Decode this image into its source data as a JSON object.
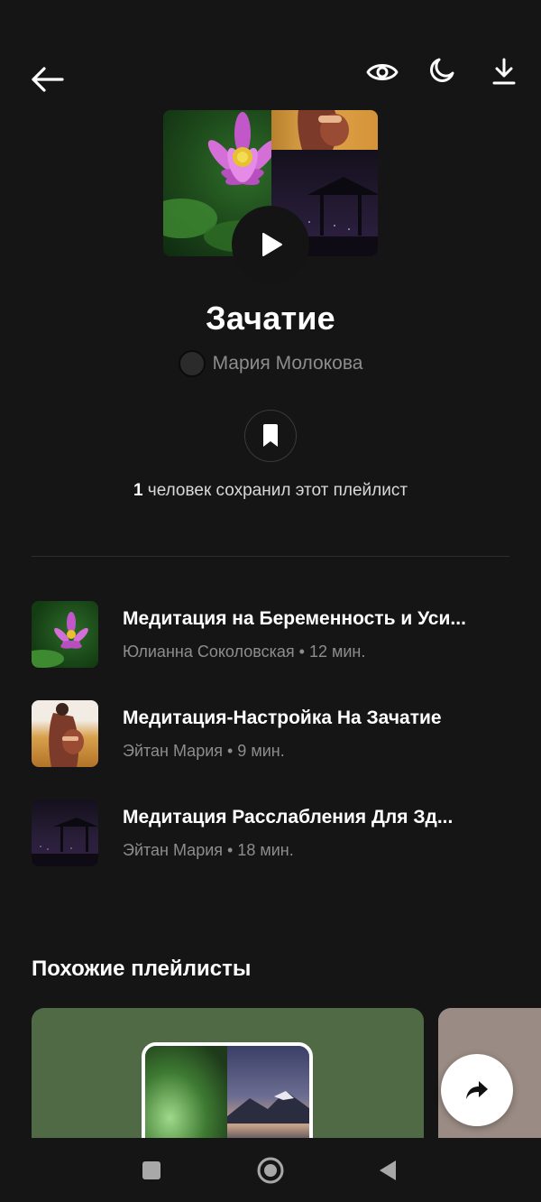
{
  "header": {
    "back_icon": "arrow-left-icon",
    "eye_icon": "eye-icon",
    "night_icon": "moon-icon",
    "download_icon": "download-icon"
  },
  "playlist": {
    "title": "Зачатие",
    "author": "Мария Молокова",
    "saved_count": "1",
    "saved_text": " человек сохранил этот плейлист"
  },
  "tracks": [
    {
      "title": "Медитация на Беременность и Уси...",
      "meta": "Юлианна Соколовская • 12 мин."
    },
    {
      "title": "Медитация-Настройка На Зачатие",
      "meta": "Эйтан Мария  • 9 мин."
    },
    {
      "title": "Медитация Расслабления Для Зд...",
      "meta": "Эйтан Мария  • 18 мин."
    }
  ],
  "similar": {
    "section_title": "Похожие плейлисты"
  },
  "colors": {
    "background": "#151515",
    "muted_text": "#8d8d8d",
    "card_green": "#4f6a44",
    "card_taupe": "#9a8c84"
  }
}
